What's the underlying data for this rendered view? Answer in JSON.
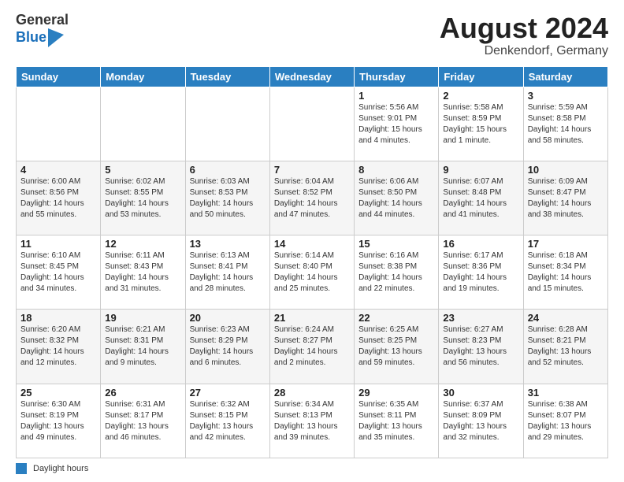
{
  "header": {
    "logo_general": "General",
    "logo_blue": "Blue",
    "month_year": "August 2024",
    "location": "Denkendorf, Germany"
  },
  "days_of_week": [
    "Sunday",
    "Monday",
    "Tuesday",
    "Wednesday",
    "Thursday",
    "Friday",
    "Saturday"
  ],
  "weeks": [
    [
      {
        "num": "",
        "info": ""
      },
      {
        "num": "",
        "info": ""
      },
      {
        "num": "",
        "info": ""
      },
      {
        "num": "",
        "info": ""
      },
      {
        "num": "1",
        "info": "Sunrise: 5:56 AM\nSunset: 9:01 PM\nDaylight: 15 hours\nand 4 minutes."
      },
      {
        "num": "2",
        "info": "Sunrise: 5:58 AM\nSunset: 8:59 PM\nDaylight: 15 hours\nand 1 minute."
      },
      {
        "num": "3",
        "info": "Sunrise: 5:59 AM\nSunset: 8:58 PM\nDaylight: 14 hours\nand 58 minutes."
      }
    ],
    [
      {
        "num": "4",
        "info": "Sunrise: 6:00 AM\nSunset: 8:56 PM\nDaylight: 14 hours\nand 55 minutes."
      },
      {
        "num": "5",
        "info": "Sunrise: 6:02 AM\nSunset: 8:55 PM\nDaylight: 14 hours\nand 53 minutes."
      },
      {
        "num": "6",
        "info": "Sunrise: 6:03 AM\nSunset: 8:53 PM\nDaylight: 14 hours\nand 50 minutes."
      },
      {
        "num": "7",
        "info": "Sunrise: 6:04 AM\nSunset: 8:52 PM\nDaylight: 14 hours\nand 47 minutes."
      },
      {
        "num": "8",
        "info": "Sunrise: 6:06 AM\nSunset: 8:50 PM\nDaylight: 14 hours\nand 44 minutes."
      },
      {
        "num": "9",
        "info": "Sunrise: 6:07 AM\nSunset: 8:48 PM\nDaylight: 14 hours\nand 41 minutes."
      },
      {
        "num": "10",
        "info": "Sunrise: 6:09 AM\nSunset: 8:47 PM\nDaylight: 14 hours\nand 38 minutes."
      }
    ],
    [
      {
        "num": "11",
        "info": "Sunrise: 6:10 AM\nSunset: 8:45 PM\nDaylight: 14 hours\nand 34 minutes."
      },
      {
        "num": "12",
        "info": "Sunrise: 6:11 AM\nSunset: 8:43 PM\nDaylight: 14 hours\nand 31 minutes."
      },
      {
        "num": "13",
        "info": "Sunrise: 6:13 AM\nSunset: 8:41 PM\nDaylight: 14 hours\nand 28 minutes."
      },
      {
        "num": "14",
        "info": "Sunrise: 6:14 AM\nSunset: 8:40 PM\nDaylight: 14 hours\nand 25 minutes."
      },
      {
        "num": "15",
        "info": "Sunrise: 6:16 AM\nSunset: 8:38 PM\nDaylight: 14 hours\nand 22 minutes."
      },
      {
        "num": "16",
        "info": "Sunrise: 6:17 AM\nSunset: 8:36 PM\nDaylight: 14 hours\nand 19 minutes."
      },
      {
        "num": "17",
        "info": "Sunrise: 6:18 AM\nSunset: 8:34 PM\nDaylight: 14 hours\nand 15 minutes."
      }
    ],
    [
      {
        "num": "18",
        "info": "Sunrise: 6:20 AM\nSunset: 8:32 PM\nDaylight: 14 hours\nand 12 minutes."
      },
      {
        "num": "19",
        "info": "Sunrise: 6:21 AM\nSunset: 8:31 PM\nDaylight: 14 hours\nand 9 minutes."
      },
      {
        "num": "20",
        "info": "Sunrise: 6:23 AM\nSunset: 8:29 PM\nDaylight: 14 hours\nand 6 minutes."
      },
      {
        "num": "21",
        "info": "Sunrise: 6:24 AM\nSunset: 8:27 PM\nDaylight: 14 hours\nand 2 minutes."
      },
      {
        "num": "22",
        "info": "Sunrise: 6:25 AM\nSunset: 8:25 PM\nDaylight: 13 hours\nand 59 minutes."
      },
      {
        "num": "23",
        "info": "Sunrise: 6:27 AM\nSunset: 8:23 PM\nDaylight: 13 hours\nand 56 minutes."
      },
      {
        "num": "24",
        "info": "Sunrise: 6:28 AM\nSunset: 8:21 PM\nDaylight: 13 hours\nand 52 minutes."
      }
    ],
    [
      {
        "num": "25",
        "info": "Sunrise: 6:30 AM\nSunset: 8:19 PM\nDaylight: 13 hours\nand 49 minutes."
      },
      {
        "num": "26",
        "info": "Sunrise: 6:31 AM\nSunset: 8:17 PM\nDaylight: 13 hours\nand 46 minutes."
      },
      {
        "num": "27",
        "info": "Sunrise: 6:32 AM\nSunset: 8:15 PM\nDaylight: 13 hours\nand 42 minutes."
      },
      {
        "num": "28",
        "info": "Sunrise: 6:34 AM\nSunset: 8:13 PM\nDaylight: 13 hours\nand 39 minutes."
      },
      {
        "num": "29",
        "info": "Sunrise: 6:35 AM\nSunset: 8:11 PM\nDaylight: 13 hours\nand 35 minutes."
      },
      {
        "num": "30",
        "info": "Sunrise: 6:37 AM\nSunset: 8:09 PM\nDaylight: 13 hours\nand 32 minutes."
      },
      {
        "num": "31",
        "info": "Sunrise: 6:38 AM\nSunset: 8:07 PM\nDaylight: 13 hours\nand 29 minutes."
      }
    ]
  ],
  "footer": {
    "legend_label": "Daylight hours"
  }
}
